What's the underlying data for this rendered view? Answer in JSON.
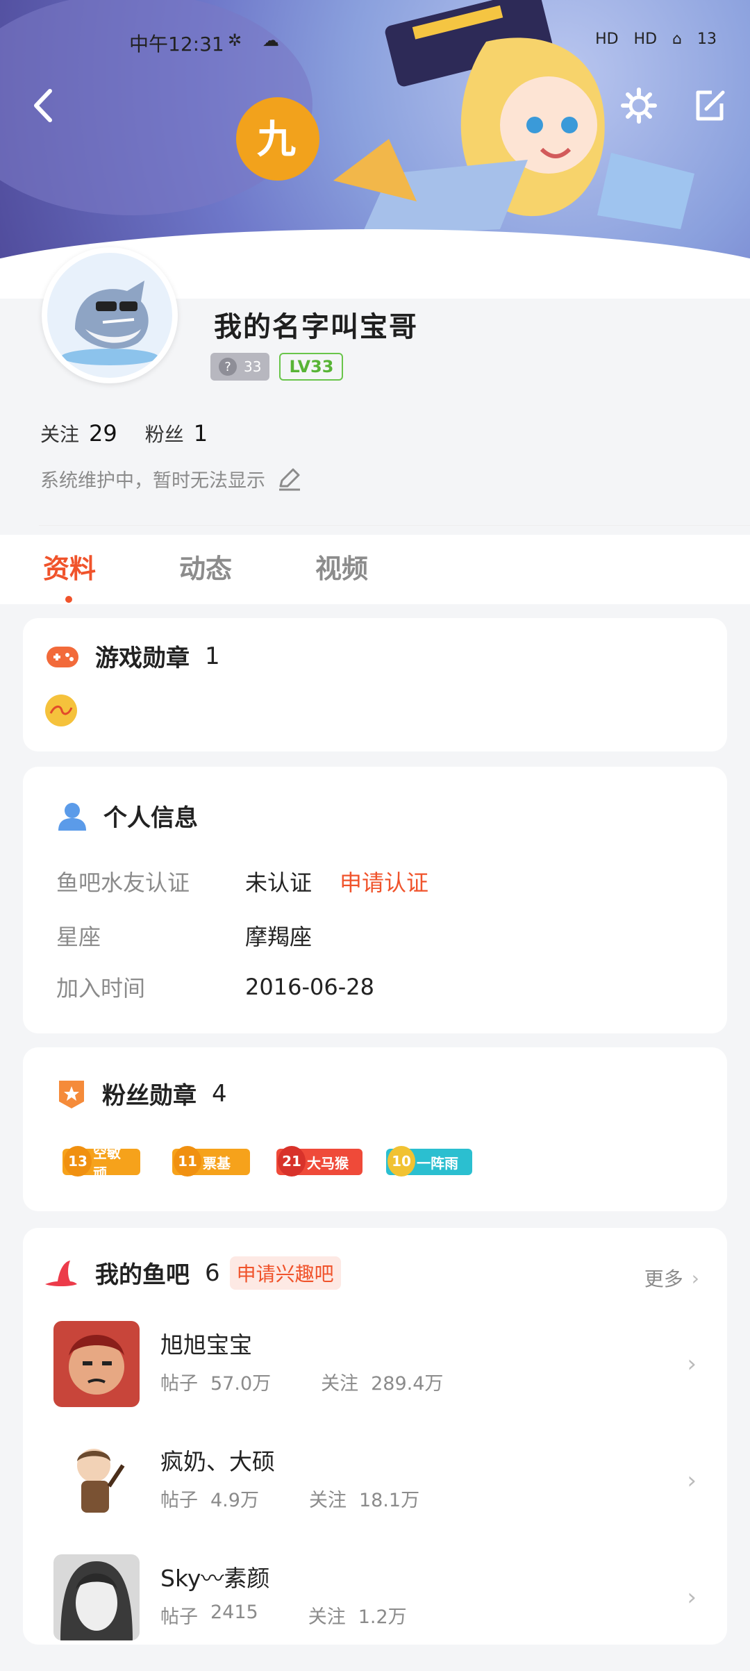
{
  "status_bar": {
    "time": "中午12:31",
    "right": [
      "HD",
      "HD",
      "13"
    ]
  },
  "profile": {
    "name": "我的名字叫宝哥",
    "badge_gray_num": "33",
    "level_badge": "LV33",
    "following_label": "关注",
    "following_count": "29",
    "fans_label": "粉丝",
    "fans_count": "1",
    "signature": "系统维护中，暂时无法显示"
  },
  "tabs": [
    {
      "label": "资料",
      "active": true
    },
    {
      "label": "动态",
      "active": false
    },
    {
      "label": "视频",
      "active": false
    }
  ],
  "game_medals": {
    "title": "游戏勋章",
    "count": "1"
  },
  "personal_info": {
    "title": "个人信息",
    "rows": [
      {
        "key": "鱼吧水友认证",
        "value": "未认证",
        "action": "申请认证"
      },
      {
        "key": "星座",
        "value": "摩羯座"
      },
      {
        "key": "加入时间",
        "value": "2016-06-28"
      }
    ]
  },
  "fan_medals": {
    "title": "粉丝勋章",
    "count": "4",
    "items": [
      {
        "level": "13",
        "label": "空敏顽",
        "color": "#f6a21b"
      },
      {
        "level": "11",
        "label": "票基",
        "color": "#f6a21b"
      },
      {
        "level": "21",
        "label": "大马猴",
        "color": "#ef4a39"
      },
      {
        "level": "10",
        "label": "一阵雨",
        "color": "#2bbfd0"
      }
    ]
  },
  "my_bars": {
    "title": "我的鱼吧",
    "count": "6",
    "apply": "申请兴趣吧",
    "more": "更多",
    "posts_label": "帖子",
    "follow_label": "关注",
    "items": [
      {
        "name": "旭旭宝宝",
        "posts": "57.0万",
        "follows": "289.4万"
      },
      {
        "name": "疯奶、大硕",
        "posts": "4.9万",
        "follows": "18.1万"
      },
      {
        "name": "Sky〰素颜",
        "posts": "2415",
        "follows": "1.2万"
      }
    ]
  }
}
